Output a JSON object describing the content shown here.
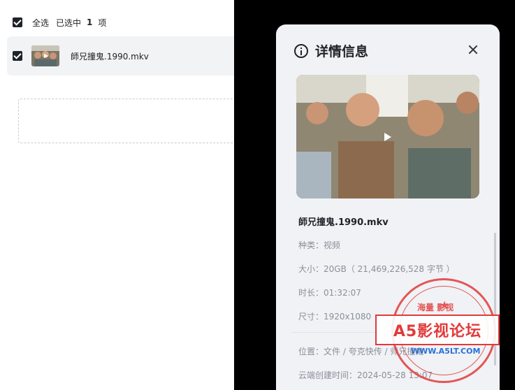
{
  "file_list": {
    "select_all_label": "全选",
    "selected_prefix": "已选中",
    "selected_count": "1",
    "selected_unit": "项",
    "items": [
      {
        "name": "師兄撞鬼.1990.mkv",
        "checked": true
      }
    ]
  },
  "details": {
    "title": "详情信息",
    "file_name": "師兄撞鬼.1990.mkv",
    "rows": [
      {
        "key": "种类：",
        "value": "视频"
      },
      {
        "key": "大小：",
        "value": "20GB（ 21,469,226,528 字节 ）"
      },
      {
        "key": "时长：",
        "value": "01:32:07"
      },
      {
        "key": "尺寸：",
        "value": "1920x1080"
      }
    ],
    "location_key": "位置：",
    "location_value": "文件 / 夸克快传 / 师兄撞鬼",
    "created_key": "云端创建时间：",
    "created_value": "2024-05-28 13:07"
  },
  "watermark": {
    "top_text": "海量 影视",
    "banner_text": "A5影视论坛",
    "url": "WWW.A5LT.COM"
  },
  "colors": {
    "panel_bg": "#f0f2f5",
    "stamp_red": "#e23a3a",
    "checkbox": "#1f2329"
  }
}
